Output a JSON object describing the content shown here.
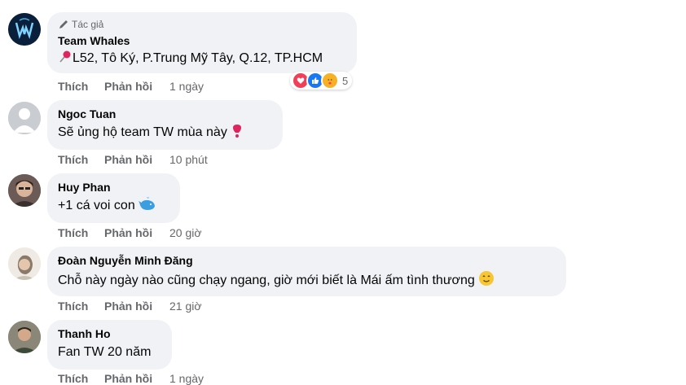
{
  "author_tag_label": "Tác giả",
  "actions": {
    "like_label": "Thích",
    "reply_label": "Phản hồi"
  },
  "comments": [
    {
      "name": "Team Whales",
      "text": "L52, Tô Ký, P.Trung Mỹ Tây, Q.12, TP.HCM",
      "time": "1 ngày",
      "reaction_count": "5",
      "reaction_icons": [
        "love-icon",
        "like-icon",
        "care-icon"
      ]
    },
    {
      "name": "Ngoc Tuan",
      "text": "Sẽ ủng hộ team TW mùa này",
      "time": "10 phút"
    },
    {
      "name": "Huy Phan",
      "text": "+1 cá voi con",
      "time": "20 giờ"
    },
    {
      "name": "Đoàn Nguyễn Minh Đăng",
      "text": "Chỗ này ngày nào cũng chạy ngang, giờ mới biết là Mái ấm tình thương",
      "time": "21 giờ"
    },
    {
      "name": "Thanh Ho",
      "text": "Fan TW 20 năm",
      "time": "1 ngày"
    }
  ],
  "colors": {
    "bubble": "#f0f2f5",
    "meta_text": "#65676b",
    "love": "#f33e58",
    "like": "#1877f2",
    "care": "#f7b125"
  }
}
